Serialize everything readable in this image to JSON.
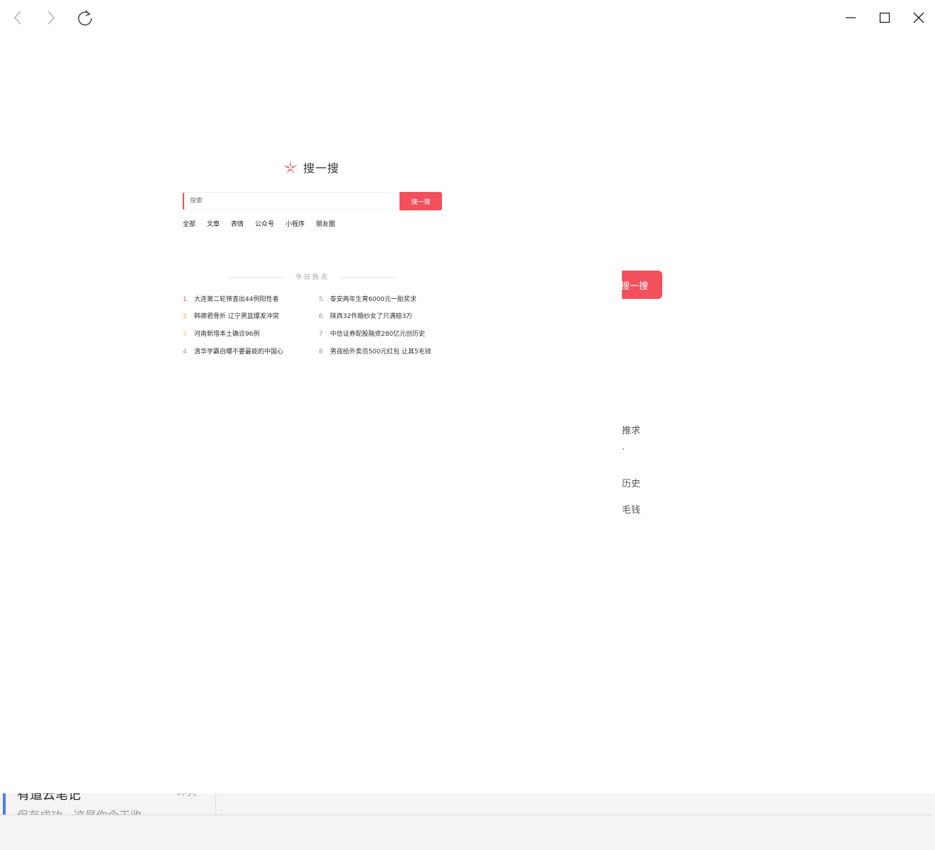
{
  "toolbar": {
    "back_icon": "chevron-left-icon",
    "forward_icon": "chevron-right-icon",
    "reload_icon": "reload-icon",
    "minimize_icon": "minimize-icon",
    "maximize_icon": "maximize-icon",
    "close_icon": "close-icon"
  },
  "logo": {
    "text": "搜一搜",
    "icon": "search-logo-icon",
    "color": "#f2505d"
  },
  "search": {
    "placeholder": "搜索",
    "button_label": "搜一搜"
  },
  "tabs": [
    "全部",
    "文章",
    "表情",
    "公众号",
    "小程序",
    "朋友圈"
  ],
  "hot": {
    "title": "今日热点",
    "items": [
      {
        "rank": "1",
        "text": "大连第二轮筛查出44例阳性者",
        "color": "#f2505d"
      },
      {
        "rank": "2",
        "text": "韩德君骨折 辽宁男篮爆发冲突",
        "color": "#f5a623"
      },
      {
        "rank": "3",
        "text": "河南新增本土确诊96例",
        "color": "#f5c26b"
      },
      {
        "rank": "4",
        "text": "清华学霸自曝不要最能的中国心",
        "color": "#999999"
      },
      {
        "rank": "5",
        "text": "泰安两年生育6000元一胎奖求",
        "color": "#999999"
      },
      {
        "rank": "6",
        "text": "陕西32件婚纱女了只满赔3万",
        "color": "#999999"
      },
      {
        "rank": "7",
        "text": "中信证券配股融资280亿元创历史",
        "color": "#999999"
      },
      {
        "rank": "8",
        "text": "男孩给外卖员500元红包 让其5毛钱",
        "color": "#999999"
      }
    ]
  },
  "ghost": {
    "button_label": "搜一搜",
    "lines": [
      "推求",
      "·",
      "历史",
      "毛钱"
    ]
  },
  "notification": {
    "title": "有道云笔记",
    "time": "昨天",
    "body": "保存成功，这是你今天收"
  }
}
